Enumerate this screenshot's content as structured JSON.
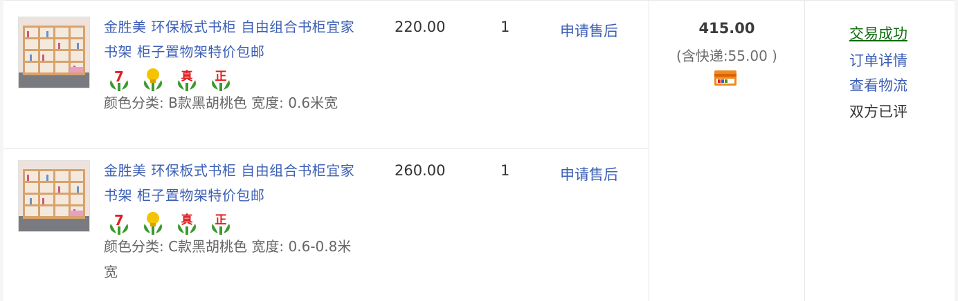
{
  "items": [
    {
      "title": "金胜美 环保板式书柜 自由组合书柜宜家书架 柜子置物架特价包邮",
      "badges": [
        "7",
        "",
        "真",
        "正"
      ],
      "spec": "颜色分类: B款黑胡桃色  宽度: 0.6米宽",
      "price": "220.00",
      "qty": "1",
      "aftersale": "申请售后"
    },
    {
      "title": "金胜美 环保板式书柜 自由组合书柜宜家书架 柜子置物架特价包邮",
      "badges": [
        "7",
        "",
        "真",
        "正"
      ],
      "spec": "颜色分类: C款黑胡桃色  宽度: 0.6-0.8米宽",
      "price": "260.00",
      "qty": "1",
      "aftersale": "申请售后"
    }
  ],
  "total": {
    "amount": "415.00",
    "shipping": "(含快递:55.00 )",
    "icon": "card-icon"
  },
  "status": {
    "success": "交易成功",
    "detail": "订单详情",
    "logistics": "查看物流",
    "rated": "双方已评"
  },
  "colors": {
    "link_blue": "#3c5fb5",
    "success_green": "#0b6b0b",
    "badge_red": "#e02020",
    "leaf_green": "#3a9a2e",
    "badge_yellow": "#f5c400"
  }
}
